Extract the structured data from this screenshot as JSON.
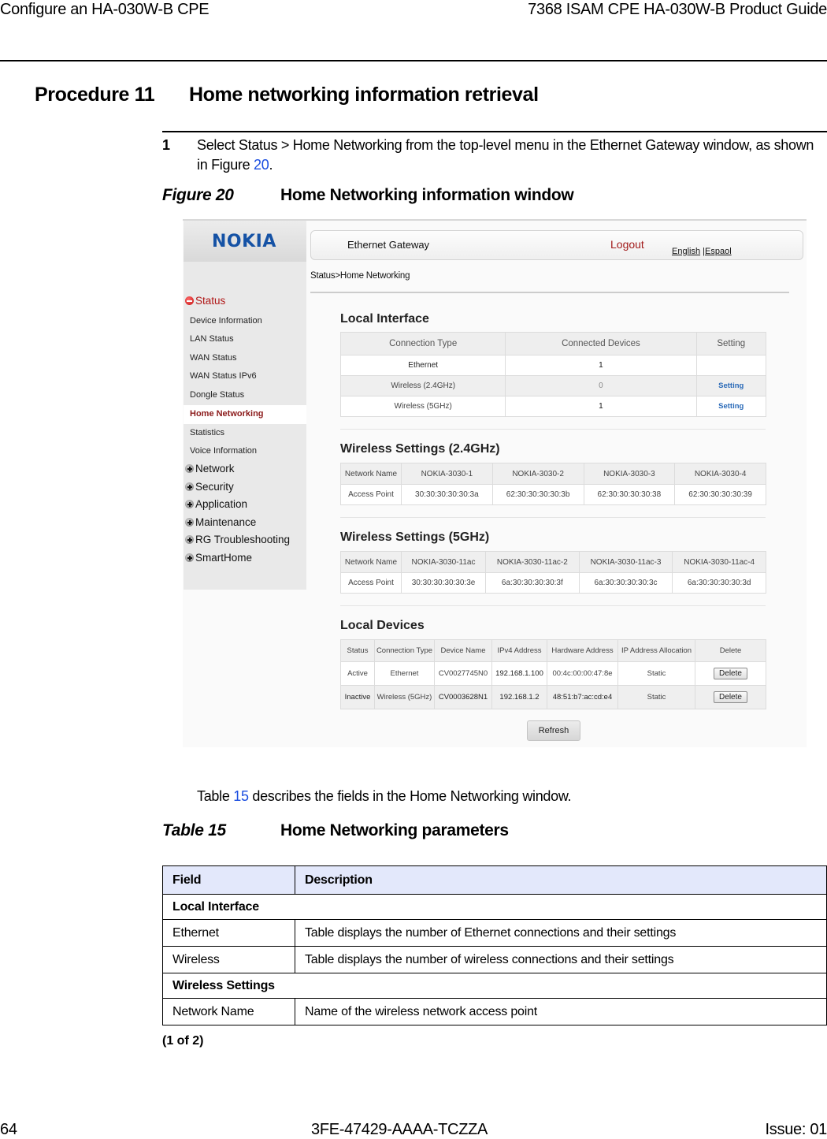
{
  "page_header": {
    "left": "Configure an HA-030W-B CPE",
    "right": "7368 ISAM CPE HA-030W-B Product Guide"
  },
  "procedure": {
    "number": "Procedure 11",
    "title": "Home networking information retrieval"
  },
  "steps": [
    {
      "num": "1",
      "text_before": "Select Status > Home Networking from the top-level menu in the Ethernet Gateway window, as shown in Figure ",
      "link": "20",
      "text_after": "."
    }
  ],
  "figure": {
    "label": "Figure 20",
    "title": "Home Networking information window"
  },
  "screenshot": {
    "logo": "NOKIA",
    "topbar": {
      "title": "Ethernet Gateway",
      "logout": "Logout",
      "lang_english": "English",
      "lang_sep": "|",
      "lang_espanol": "Espaol"
    },
    "breadcrumb": "Status>Home Networking",
    "sidebar": {
      "status_section": "Status",
      "status_items": [
        "Device Information",
        "LAN Status",
        "WAN Status",
        "WAN Status IPv6",
        "Dongle Status"
      ],
      "active_item": "Home Networking",
      "status_items_after": [
        "Statistics",
        "Voice Information"
      ],
      "collapsed_sections": [
        "Network",
        "Security",
        "Application",
        "Maintenance",
        "RG Troubleshooting",
        "SmartHome"
      ]
    },
    "local_interface": {
      "title": "Local Interface",
      "headers": [
        "Connection Type",
        "Connected Devices",
        "Setting"
      ],
      "rows": [
        {
          "type": "Ethernet",
          "devices": "1",
          "setting": ""
        },
        {
          "type": "Wireless (2.4GHz)",
          "devices": "0",
          "setting": "Setting"
        },
        {
          "type": "Wireless (5GHz)",
          "devices": "1",
          "setting": "Setting"
        }
      ]
    },
    "wireless_24": {
      "title": "Wireless Settings (2.4GHz)",
      "name_label": "Network Name",
      "ap_label": "Access Point",
      "names": [
        "NOKIA-3030-1",
        "NOKIA-3030-2",
        "NOKIA-3030-3",
        "NOKIA-3030-4"
      ],
      "access_points": [
        "30:30:30:30:30:3a",
        "62:30:30:30:30:3b",
        "62:30:30:30:30:38",
        "62:30:30:30:30:39"
      ]
    },
    "wireless_5": {
      "title": "Wireless Settings (5GHz)",
      "name_label": "Network Name",
      "ap_label": "Access Point",
      "names": [
        "NOKIA-3030-11ac",
        "NOKIA-3030-11ac-2",
        "NOKIA-3030-11ac-3",
        "NOKIA-3030-11ac-4"
      ],
      "access_points": [
        "30:30:30:30:30:3e",
        "6a:30:30:30:30:3f",
        "6a:30:30:30:30:3c",
        "6a:30:30:30:30:3d"
      ]
    },
    "local_devices": {
      "title": "Local Devices",
      "headers": [
        "Status",
        "Connection Type",
        "Device Name",
        "IPv4 Address",
        "Hardware Address",
        "IP Address Allocation",
        "Delete"
      ],
      "rows": [
        {
          "status": "Active",
          "conn": "Ethernet",
          "name": "CV0027745N0",
          "ipv4": "192.168.1.100",
          "hw": "00:4c:00:00:47:8e",
          "alloc": "Static",
          "delete": "Delete"
        },
        {
          "status": "Inactive",
          "conn": "Wireless (5GHz)",
          "name": "CV0003628N1",
          "ipv4": "192.168.1.2",
          "hw": "48:51:b7:ac:cd:e4",
          "alloc": "Static",
          "delete": "Delete"
        }
      ]
    },
    "refresh_label": "Refresh"
  },
  "table_intro": {
    "before": "Table ",
    "link": "15",
    "after": " describes the fields in the Home Networking window."
  },
  "table": {
    "label": "Table 15",
    "title": "Home Networking parameters",
    "headers": [
      "Field",
      "Description"
    ],
    "groups": [
      {
        "name": "Local Interface",
        "rows": [
          {
            "field": "Ethernet",
            "description": "Table displays the number of Ethernet connections and their settings"
          },
          {
            "field": "Wireless",
            "description": "Table displays the number of wireless connections and their settings"
          }
        ]
      },
      {
        "name": "Wireless Settings",
        "rows": [
          {
            "field": "Network Name",
            "description": "Name of the wireless network access point"
          }
        ]
      }
    ],
    "continuation": "(1 of 2)"
  },
  "page_footer": {
    "page_number": "64",
    "doc_id": "3FE-47429-AAAA-TCZZA",
    "issue": "Issue: 01"
  }
}
